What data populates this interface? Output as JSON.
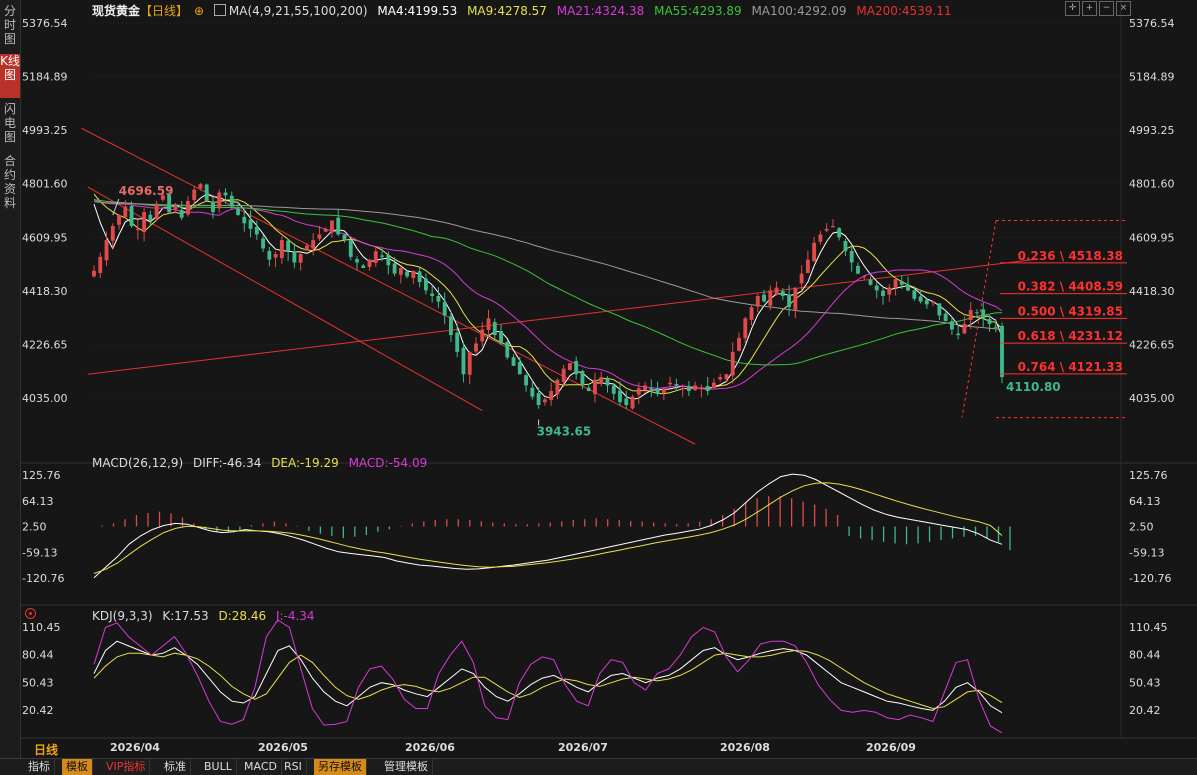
{
  "sidebar": {
    "tabs": [
      {
        "label": "分时图",
        "active": false
      },
      {
        "label": "K线图",
        "active": true
      },
      {
        "label": "闪电图",
        "active": false
      },
      {
        "label": "合约资料",
        "active": false
      }
    ]
  },
  "header": {
    "symbol": "现货黄金",
    "period_tag": "【日线】",
    "ma_config": "MA(4,9,21,55,100,200)",
    "ma4": "MA4:4199.53",
    "ma9": "MA9:4278.57",
    "ma21": "MA21:4324.38",
    "ma55": "MA55:4293.89",
    "ma100": "MA100:4292.09",
    "ma200": "MA200:4539.11"
  },
  "macd_header": {
    "name": "MACD(26,12,9)",
    "diff": "DIFF:-46.34",
    "dea": "DEA:-19.29",
    "macd": "MACD:-54.09"
  },
  "kdj_header": {
    "name": "KDJ(9,3,3)",
    "k": "K:17.53",
    "d": "D:28.46",
    "j": "J:-4.34"
  },
  "period_label": "日线",
  "bottom_tabs": [
    {
      "label": "指标",
      "style": "normal"
    },
    {
      "label": "模板",
      "style": "active"
    },
    {
      "label": "VIP指标",
      "style": "vip"
    },
    {
      "label": "标准",
      "style": "normal"
    },
    {
      "label": "BULL",
      "style": "normal"
    },
    {
      "label": "MACD",
      "style": "normal"
    },
    {
      "label": "RSI",
      "style": "normal"
    },
    {
      "label": "另存模板",
      "style": "active"
    },
    {
      "label": "管理模板",
      "style": "normal"
    }
  ],
  "colors": {
    "up": "#e04a4a",
    "down": "#3fb88a",
    "ma4": "#ffffff",
    "ma9": "#e8e04a",
    "ma21": "#d83ad8",
    "ma55": "#3ac43a",
    "ma100": "#9a9a9a",
    "ma200": "#e83030",
    "fib": "#ff3030",
    "grid": "#2b2b2b"
  },
  "chart_data": [
    {
      "type": "candlestick",
      "title": "现货黄金 【日线】",
      "y_ticks": [
        "5376.54",
        "5184.89",
        "4993.25",
        "4801.60",
        "4609.95",
        "4418.30",
        "4226.65",
        "4035.00"
      ],
      "ylim": [
        3880,
        5380
      ],
      "x_ticks": [
        "2026/04",
        "2026/05",
        "2026/06",
        "2026/07",
        "2026/08",
        "2026/09"
      ],
      "annotations": [
        {
          "label": "4696.59",
          "value": 4696.59,
          "kind": "high"
        },
        {
          "label": "3943.65",
          "value": 3943.65,
          "kind": "low"
        },
        {
          "label": "4110.80",
          "value": 4110.8,
          "kind": "last"
        }
      ],
      "fibonacci": [
        {
          "label": "0.236 \\ 4518.38",
          "value": 4518.38
        },
        {
          "label": "0.382 \\ 4408.59",
          "value": 4408.59
        },
        {
          "label": "0.500 \\ 4319.85",
          "value": 4319.85
        },
        {
          "label": "0.618 \\ 4231.12",
          "value": 4231.12
        },
        {
          "label": "0.764 \\ 4121.33",
          "value": 4121.33
        }
      ],
      "fib_frame": {
        "top": 4670,
        "bottom": 3965
      },
      "closes": [
        4490,
        4540,
        4600,
        4650,
        4690,
        4720,
        4650,
        4640,
        4700,
        4670,
        4730,
        4760,
        4700,
        4720,
        4680,
        4740,
        4780,
        4800,
        4740,
        4700,
        4770,
        4760,
        4720,
        4690,
        4660,
        4640,
        4620,
        4570,
        4530,
        4550,
        4600,
        4560,
        4520,
        4550,
        4580,
        4600,
        4620,
        4640,
        4670,
        4620,
        4600,
        4540,
        4520,
        4500,
        4530,
        4560,
        4540,
        4510,
        4480,
        4500,
        4470,
        4490,
        4450,
        4420,
        4400,
        4380,
        4330,
        4260,
        4200,
        4120,
        4200,
        4230,
        4280,
        4320,
        4260,
        4230,
        4180,
        4150,
        4120,
        4080,
        4040,
        4010,
        4030,
        4060,
        4100,
        4140,
        4160,
        4120,
        4080,
        4060,
        4100,
        4110,
        4080,
        4050,
        4020,
        4010,
        4040,
        4070,
        4080,
        4060,
        4050,
        4070,
        4090,
        4080,
        4070,
        4060,
        4080,
        4070,
        4060,
        4090,
        4110,
        4120,
        4200,
        4250,
        4320,
        4360,
        4400,
        4380,
        4420,
        4430,
        4400,
        4360,
        4430,
        4480,
        4530,
        4590,
        4620,
        4640,
        4650,
        4610,
        4560,
        4520,
        4480,
        4470,
        4440,
        4420,
        4400,
        4430,
        4460,
        4440,
        4420,
        4390,
        4380,
        4370,
        4380,
        4330,
        4310,
        4280,
        4260,
        4300,
        4350,
        4340,
        4320,
        4300,
        4290,
        4110
      ]
    },
    {
      "type": "bar+line",
      "title": "MACD(26,12,9)",
      "y_ticks": [
        "125.76",
        "64.13",
        "2.50",
        "-59.13",
        "-120.76"
      ],
      "ylim": [
        -146,
        150
      ],
      "series": [
        {
          "name": "DIFF",
          "values": [
            -120,
            -95,
            -70,
            -40,
            -20,
            -5,
            5,
            10,
            8,
            0,
            -8,
            -12,
            -10,
            -5,
            -8,
            -10,
            -15,
            -22,
            -30,
            -40,
            -50,
            -58,
            -62,
            -65,
            -68,
            -72,
            -80,
            -85,
            -90,
            -92,
            -95,
            -98,
            -100,
            -99,
            -96,
            -93,
            -90,
            -86,
            -82,
            -78,
            -72,
            -66,
            -60,
            -54,
            -48,
            -42,
            -36,
            -30,
            -24,
            -18,
            -14,
            -9,
            -4,
            5,
            18,
            35,
            60,
            85,
            105,
            122,
            128,
            125,
            115,
            100,
            85,
            70,
            55,
            42,
            32,
            25,
            20,
            15,
            10,
            5,
            0,
            -5,
            -15,
            -30,
            -40
          ]
        },
        {
          "name": "DEA",
          "values": [
            -110,
            -100,
            -85,
            -65,
            -45,
            -28,
            -12,
            -2,
            3,
            2,
            -2,
            -6,
            -8,
            -8,
            -8,
            -9,
            -11,
            -14,
            -19,
            -25,
            -32,
            -39,
            -46,
            -52,
            -57,
            -61,
            -66,
            -71,
            -76,
            -80,
            -84,
            -88,
            -91,
            -94,
            -95,
            -94,
            -93,
            -90,
            -87,
            -84,
            -80,
            -76,
            -71,
            -66,
            -60,
            -55,
            -49,
            -44,
            -38,
            -33,
            -28,
            -23,
            -18,
            -12,
            -4,
            6,
            20,
            37,
            55,
            73,
            88,
            100,
            106,
            107,
            104,
            98,
            90,
            81,
            72,
            63,
            55,
            47,
            40,
            33,
            26,
            20,
            14,
            5,
            -19
          ]
        }
      ],
      "histogram": [
        5,
        10,
        20,
        30,
        35,
        38,
        34,
        24,
        10,
        -4,
        -10,
        -12,
        -6,
        6,
        10,
        14,
        10,
        4,
        -8,
        -15,
        -20,
        -25,
        -22,
        -18,
        -10,
        -4,
        4,
        10,
        15,
        18,
        20,
        20,
        18,
        15,
        12,
        10,
        8,
        8,
        10,
        12,
        15,
        18,
        20,
        22,
        20,
        18,
        16,
        14,
        12,
        10,
        8,
        10,
        14,
        20,
        30,
        45,
        60,
        70,
        75,
        75,
        70,
        62,
        55,
        45,
        30,
        -20,
        -26,
        -30,
        -34,
        -38,
        -40,
        -38,
        -34,
        -30,
        -26,
        -22,
        -20,
        -26,
        -35,
        -54
      ]
    },
    {
      "type": "line",
      "title": "KDJ(9,3,3)",
      "y_ticks": [
        "110.45",
        "80.44",
        "50.43",
        "20.42"
      ],
      "ylim": [
        5,
        125
      ],
      "series": [
        {
          "name": "K",
          "values": [
            60,
            85,
            95,
            90,
            85,
            80,
            82,
            88,
            80,
            70,
            55,
            40,
            30,
            28,
            35,
            60,
            85,
            90,
            75,
            55,
            40,
            30,
            25,
            35,
            45,
            50,
            48,
            42,
            38,
            35,
            45,
            55,
            65,
            60,
            45,
            35,
            30,
            38,
            48,
            55,
            58,
            52,
            45,
            40,
            50,
            58,
            60,
            55,
            50,
            55,
            58,
            65,
            75,
            85,
            88,
            80,
            75,
            78,
            82,
            85,
            87,
            85,
            80,
            70,
            60,
            50,
            45,
            40,
            35,
            30,
            28,
            25,
            22,
            20,
            30,
            45,
            50,
            40,
            25,
            17.53
          ]
        },
        {
          "name": "D",
          "values": [
            55,
            68,
            78,
            82,
            82,
            80,
            78,
            82,
            80,
            76,
            68,
            58,
            46,
            38,
            32,
            38,
            55,
            72,
            80,
            72,
            58,
            45,
            36,
            32,
            36,
            42,
            46,
            48,
            46,
            42,
            40,
            44,
            50,
            56,
            56,
            48,
            40,
            34,
            38,
            45,
            50,
            54,
            52,
            48,
            46,
            50,
            54,
            56,
            54,
            52,
            54,
            58,
            64,
            72,
            80,
            82,
            80,
            78,
            78,
            80,
            83,
            85,
            84,
            80,
            74,
            66,
            58,
            50,
            44,
            38,
            34,
            30,
            26,
            22,
            24,
            32,
            40,
            42,
            36,
            28.46
          ]
        },
        {
          "name": "J",
          "values": [
            70,
            110,
            115,
            100,
            90,
            80,
            90,
            100,
            82,
            58,
            30,
            8,
            5,
            10,
            45,
            100,
            118,
            110,
            65,
            22,
            4,
            5,
            8,
            45,
            65,
            68,
            54,
            32,
            22,
            22,
            60,
            80,
            95,
            72,
            25,
            12,
            10,
            50,
            70,
            78,
            75,
            48,
            30,
            25,
            60,
            75,
            72,
            50,
            42,
            60,
            65,
            80,
            100,
            110,
            105,
            78,
            62,
            75,
            92,
            95,
            95,
            90,
            72,
            48,
            32,
            20,
            18,
            20,
            18,
            12,
            10,
            15,
            12,
            8,
            40,
            72,
            75,
            32,
            3,
            -4.34
          ]
        }
      ]
    }
  ]
}
